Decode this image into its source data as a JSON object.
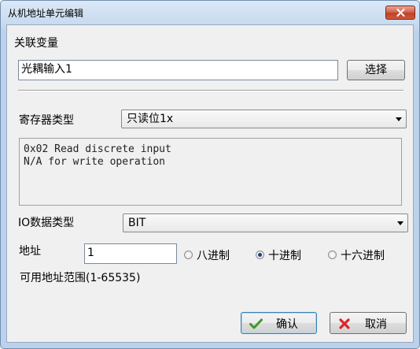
{
  "window": {
    "title": "从机地址单元编辑"
  },
  "variable": {
    "label": "关联变量",
    "value": "光耦输入1",
    "select_label": "选择"
  },
  "register": {
    "label": "寄存器类型",
    "selected": "只读位1x"
  },
  "description": {
    "line1": "0x02 Read discrete input",
    "line2": "N/A for write operation"
  },
  "io_type": {
    "label": "IO数据类型",
    "selected": "BIT"
  },
  "address": {
    "label": "地址",
    "value": "1",
    "radios": [
      {
        "label": "八进制",
        "checked": false
      },
      {
        "label": "十进制",
        "checked": true
      },
      {
        "label": "十六进制",
        "checked": false
      }
    ],
    "range_text": "可用地址范围(1-65535)"
  },
  "footer": {
    "ok_label": "确认",
    "cancel_label": "取消"
  },
  "colors": {
    "accent": "#3c7fb1",
    "check_green": "#3a9a2a",
    "cancel_red": "#d8262b"
  },
  "icons": {
    "ok": "check-icon",
    "cancel": "x-icon",
    "close": "close-icon"
  }
}
